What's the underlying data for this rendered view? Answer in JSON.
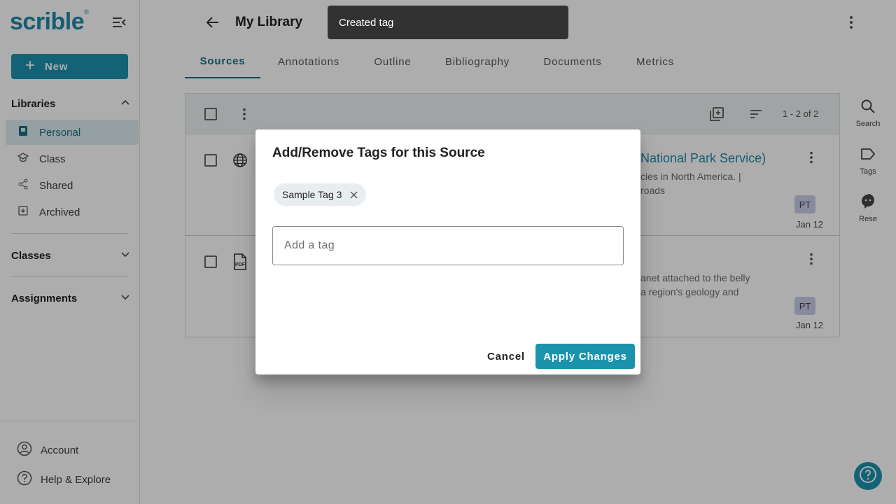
{
  "app": {
    "logo_text": "scrible",
    "logo_mark": "®",
    "accent_color": "#1b93ad"
  },
  "sidebar": {
    "new_label": "New",
    "libraries_label": "Libraries",
    "items": [
      {
        "label": "Personal",
        "icon": "book-icon",
        "active": true
      },
      {
        "label": "Class",
        "icon": "school-icon",
        "active": false
      },
      {
        "label": "Shared",
        "icon": "share-icon",
        "active": false
      },
      {
        "label": "Archived",
        "icon": "archive-icon",
        "active": false
      }
    ],
    "classes_label": "Classes",
    "assignments_label": "Assignments",
    "account_label": "Account",
    "help_label": "Help & Explore"
  },
  "header": {
    "title": "My Library"
  },
  "tabs": [
    {
      "label": "Sources",
      "active": true
    },
    {
      "label": "Annotations",
      "active": false
    },
    {
      "label": "Outline",
      "active": false
    },
    {
      "label": "Bibliography",
      "active": false
    },
    {
      "label": "Documents",
      "active": false
    },
    {
      "label": "Metrics",
      "active": false
    }
  ],
  "list": {
    "count_text": "1 - 2 of 2",
    "rows": [
      {
        "type_icon": "globe-icon",
        "title_visible": "National Park Service)",
        "desc_line1": "cies in North America.  |",
        "desc_line2": "roads",
        "avatar": "PT",
        "date": "Jan 12"
      },
      {
        "type_icon": "pdf-icon",
        "title_visible": "",
        "desc_line1": "anet attached to the belly",
        "desc_line2": "a region's geology and",
        "avatar": "PT",
        "date": "Jan 12"
      }
    ]
  },
  "rightbar": {
    "search_label": "Search",
    "tags_label": "Tags",
    "research_label": "Rese"
  },
  "snackbar": {
    "message": "Created tag"
  },
  "dialog": {
    "title": "Add/Remove Tags for this Source",
    "tags": [
      "Sample Tag 3"
    ],
    "input_placeholder": "Add a tag",
    "input_value": "",
    "cancel_label": "Cancel",
    "apply_label": "Apply Changes"
  }
}
